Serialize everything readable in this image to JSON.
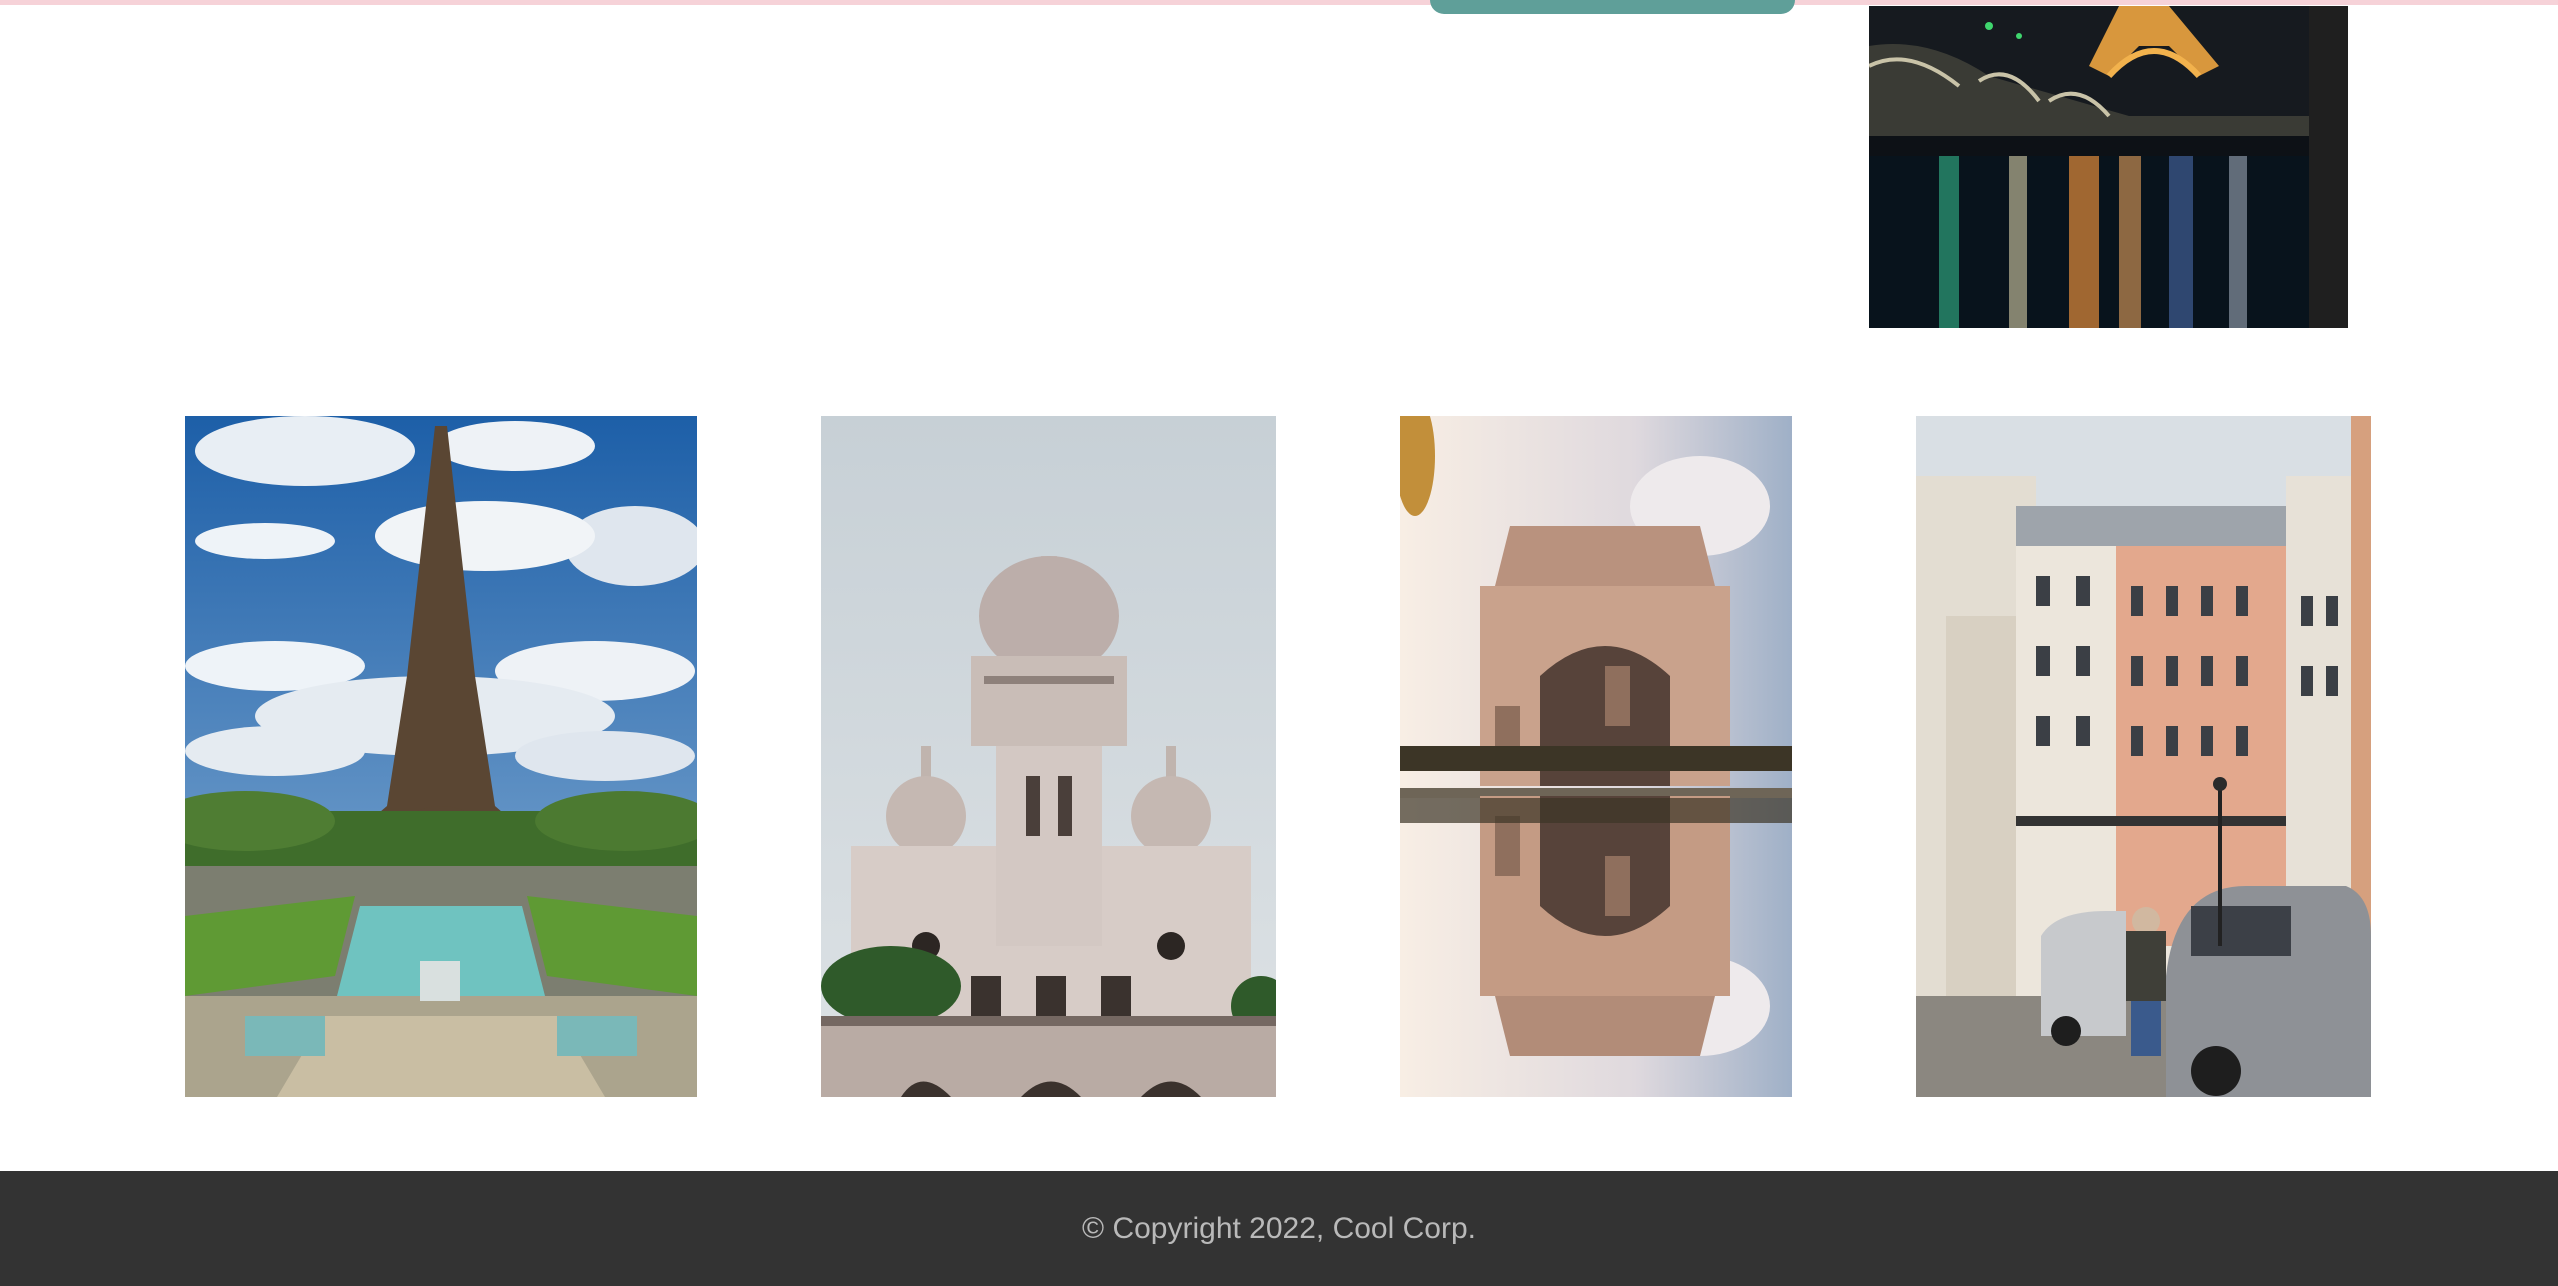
{
  "footer": {
    "copyright": "© Copyright 2022, Cool Corp."
  },
  "colors": {
    "top_bar": "#f6d2d8",
    "accent_button": "#5f9f99",
    "footer_bg": "#333333",
    "footer_text": "#b9b9b9"
  },
  "gallery": {
    "images": [
      {
        "name": "eiffel-tower-night-river",
        "icon": "photo-icon"
      },
      {
        "name": "eiffel-tower-day",
        "icon": "photo-icon"
      },
      {
        "name": "sacre-coeur-basilica",
        "icon": "photo-icon"
      },
      {
        "name": "arc-de-triomphe-reflection",
        "icon": "photo-icon"
      },
      {
        "name": "paris-street-buildings",
        "icon": "photo-icon"
      }
    ]
  }
}
